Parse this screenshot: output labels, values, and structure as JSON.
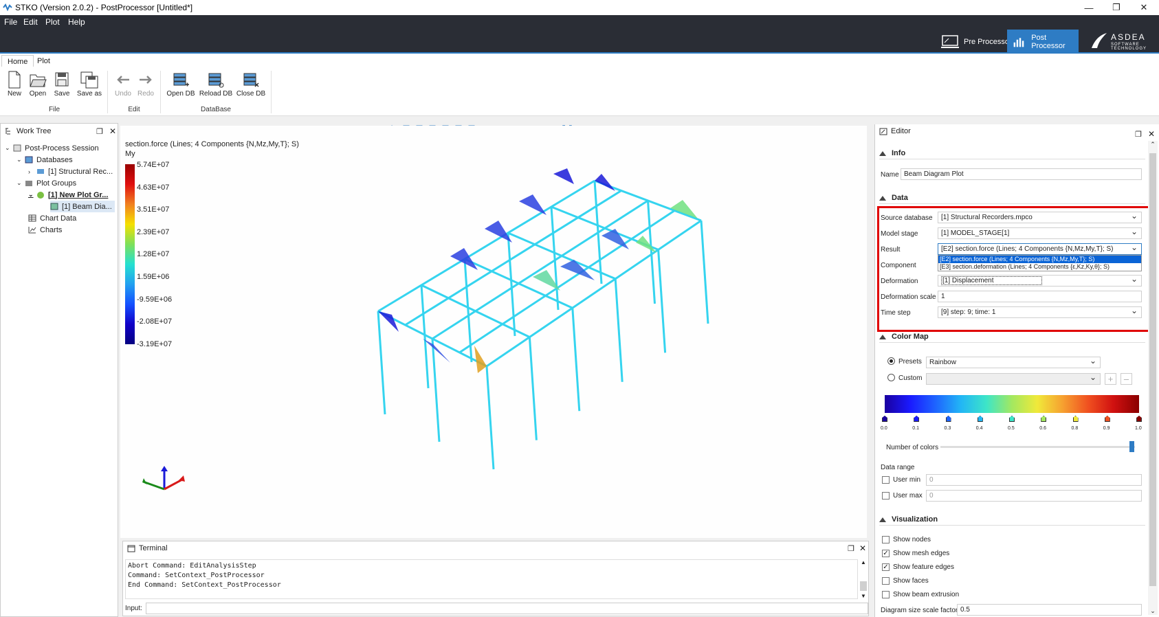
{
  "window": {
    "title": "STKO (Version 2.0.2) - PostProcessor [Untitled*]",
    "minimize": "—",
    "maximize": "❐",
    "close": "✕"
  },
  "menu": [
    "File",
    "Edit",
    "Plot",
    "Help"
  ],
  "modes": {
    "pre": "Pre Processor",
    "post": "Post Processor",
    "logo_line1": "ASDEA",
    "logo_line2": "SOFTWARE TECHNOLOGY"
  },
  "ribbon": {
    "tabs": [
      "Home",
      "Plot"
    ],
    "file": {
      "new": "New",
      "open": "Open",
      "save": "Save",
      "save_as": "Save as",
      "group": "File"
    },
    "edit": {
      "undo": "Undo",
      "redo": "Redo",
      "group": "Edit"
    },
    "database": {
      "open_db": "Open DB",
      "reload_db": "Reload DB",
      "close_db": "Close DB",
      "group": "DataBase"
    }
  },
  "work_tree": {
    "title": "Work Tree",
    "session": "Post-Process Session",
    "databases": "Databases",
    "db_item": "[1] Structural Rec...",
    "plot_groups": "Plot Groups",
    "plot_group_item": "[1] New Plot Gr...",
    "beam_item": "[1] Beam Dia...",
    "chart_data": "Chart Data",
    "charts": "Charts"
  },
  "viewport": {
    "result_label": "section.force (Lines; 4 Components {N,Mz,My,T}; S)",
    "component": "My",
    "legend_values": [
      "5.74E+07",
      "4.63E+07",
      "3.51E+07",
      "2.39E+07",
      "1.28E+07",
      "1.59E+06",
      "-9.59E+06",
      "-2.08E+07",
      "-3.19E+07"
    ]
  },
  "terminal": {
    "title": "Terminal",
    "lines": [
      "Abort Command: EditAnalysisStep",
      "Command: SetContext_PostProcessor",
      "End Command: SetContext_PostProcessor"
    ],
    "input_label": "Input:"
  },
  "editor": {
    "title": "Editor",
    "info": {
      "section": "Info",
      "name_label": "Name",
      "name_value": "Beam Diagram Plot"
    },
    "data": {
      "section": "Data",
      "source_db_label": "Source database",
      "source_db_value": "[1] Structural Recorders.mpco",
      "model_stage_label": "Model stage",
      "model_stage_value": "[1] MODEL_STAGE[1]",
      "result_label": "Result",
      "result_value": "[E2] section.force (Lines; 4 Components {N,Mz,My,T}; S)",
      "result_options": [
        "[E2] section.force (Lines; 4 Components {N,Mz,My,T}; S)",
        "[E3] section.deformation (Lines; 4 Components {ε,Kz,Ky,θ}; S)"
      ],
      "component_label": "Component",
      "deformation_label": "Deformation",
      "deformation_value": "[1] Displacement",
      "deformation_scale_label": "Deformation scale",
      "deformation_scale_value": "1",
      "time_step_label": "Time step",
      "time_step_value": "[9] step: 9; time: 1"
    },
    "color_map": {
      "section": "Color Map",
      "presets_label": "Presets",
      "presets_value": "Rainbow",
      "custom_label": "Custom",
      "ticks": [
        "0.0",
        "0.1",
        "0.3",
        "0.4",
        "0.5",
        "0.6",
        "0.8",
        "0.9",
        "1.0"
      ],
      "number_of_colors_label": "Number of colors",
      "data_range_label": "Data range",
      "user_min_label": "User min",
      "user_min_value": "0",
      "user_max_label": "User max",
      "user_max_value": "0"
    },
    "visualization": {
      "section": "Visualization",
      "show_nodes": "Show nodes",
      "show_mesh_edges": "Show mesh edges",
      "show_feature_edges": "Show feature edges",
      "show_faces": "Show faces",
      "show_beam_extrusion": "Show beam extrusion",
      "diagram_scale_label": "Diagram size scale factor",
      "diagram_scale_value": "0.5"
    }
  },
  "colors": {
    "accent": "#2e7cc4",
    "menubar": "#2a2d35",
    "highlight": "#e00000",
    "frame": "#35d4ef"
  }
}
